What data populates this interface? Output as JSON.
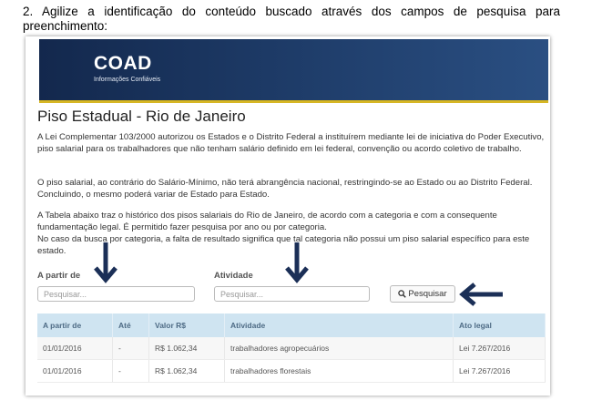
{
  "instruction": "2. Agilize a identificação do conteúdo buscado através dos campos de pesquisa para preenchimento:",
  "header": {
    "logo_text": "COAD",
    "logo_subtitle": "Informações Confiáveis"
  },
  "page": {
    "title": "Piso Estadual - Rio de Janeiro",
    "paragraphs": [
      "A Lei Complementar 103/2000 autorizou os Estados e o Distrito Federal a instituírem mediante lei de iniciativa do Poder Executivo, piso salarial para os trabalhadores que não tenham salário definido em lei federal, convenção ou acordo coletivo de trabalho.",
      "O piso salarial, ao contrário do Salário-Mínimo, não terá abrangência nacional, restringindo-se ao Estado ou ao Distrito Federal. Concluindo, o mesmo poderá variar de Estado para Estado.",
      "A Tabela abaixo traz o histórico dos pisos salariais do Rio de Janeiro, de acordo com a categoria e com a consequente fundamentação legal. É permitido fazer pesquisa por ano ou por categoria.",
      "No caso da busca por categoria, a falta de resultado significa que tal categoria não possui um piso salarial específico para este estado."
    ]
  },
  "search": {
    "from_label": "A partir de",
    "from_placeholder": "Pesquisar...",
    "activity_label": "Atividade",
    "activity_placeholder": "Pesquisar...",
    "button_label": "Pesquisar"
  },
  "table": {
    "headers": [
      "A partir de",
      "Até",
      "Valor R$",
      "Atividade",
      "Ato legal"
    ],
    "rows": [
      [
        "01/01/2016",
        "-",
        "R$ 1.062,34",
        "trabalhadores agropecuários",
        "Lei 7.267/2016"
      ],
      [
        "01/01/2016",
        "-",
        "R$ 1.062,34",
        "trabalhadores florestais",
        "Lei 7.267/2016"
      ]
    ]
  },
  "colors": {
    "banner": "#1d3a66",
    "banner_stripe": "#d6b624",
    "table_header": "#cfe4f1",
    "annotation_arrow": "#1b2f57"
  },
  "icons": [
    "search-icon",
    "arrow-down-icon",
    "arrow-left-icon"
  ]
}
